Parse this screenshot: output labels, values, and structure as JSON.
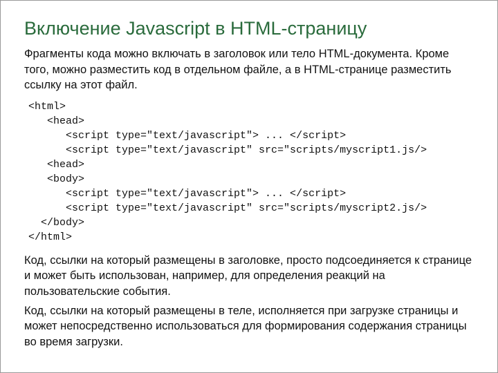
{
  "title": "Включение Javascript в HTML-страницу",
  "intro": "Фрагменты кода можно включать в заголовок или тело HTML-документа. Кроме того, можно разместить код в отдельном файле, а в HTML-странице разместить ссылку на этот файл.",
  "code": "<html>\n   <head>\n      <script type=\"text/javascript\"> ... </script>\n      <script type=\"text/javascript\" src=\"scripts/myscript1.js/>\n   <head>\n   <body>\n      <script type=\"text/javascript\"> ... </script>\n      <script type=\"text/javascript\" src=\"scripts/myscript2.js/>\n  </body>\n</html>",
  "outro1": "Код, ссылки на который размещены в заголовке, просто подсоединяется к странице и может быть использован, например, для определения реакций на пользовательские события.",
  "outro2": "Код, ссылки на который размещены в теле, исполняется при загрузке страницы и может непосредственно использоваться для формирования содержания страницы во время загрузки."
}
